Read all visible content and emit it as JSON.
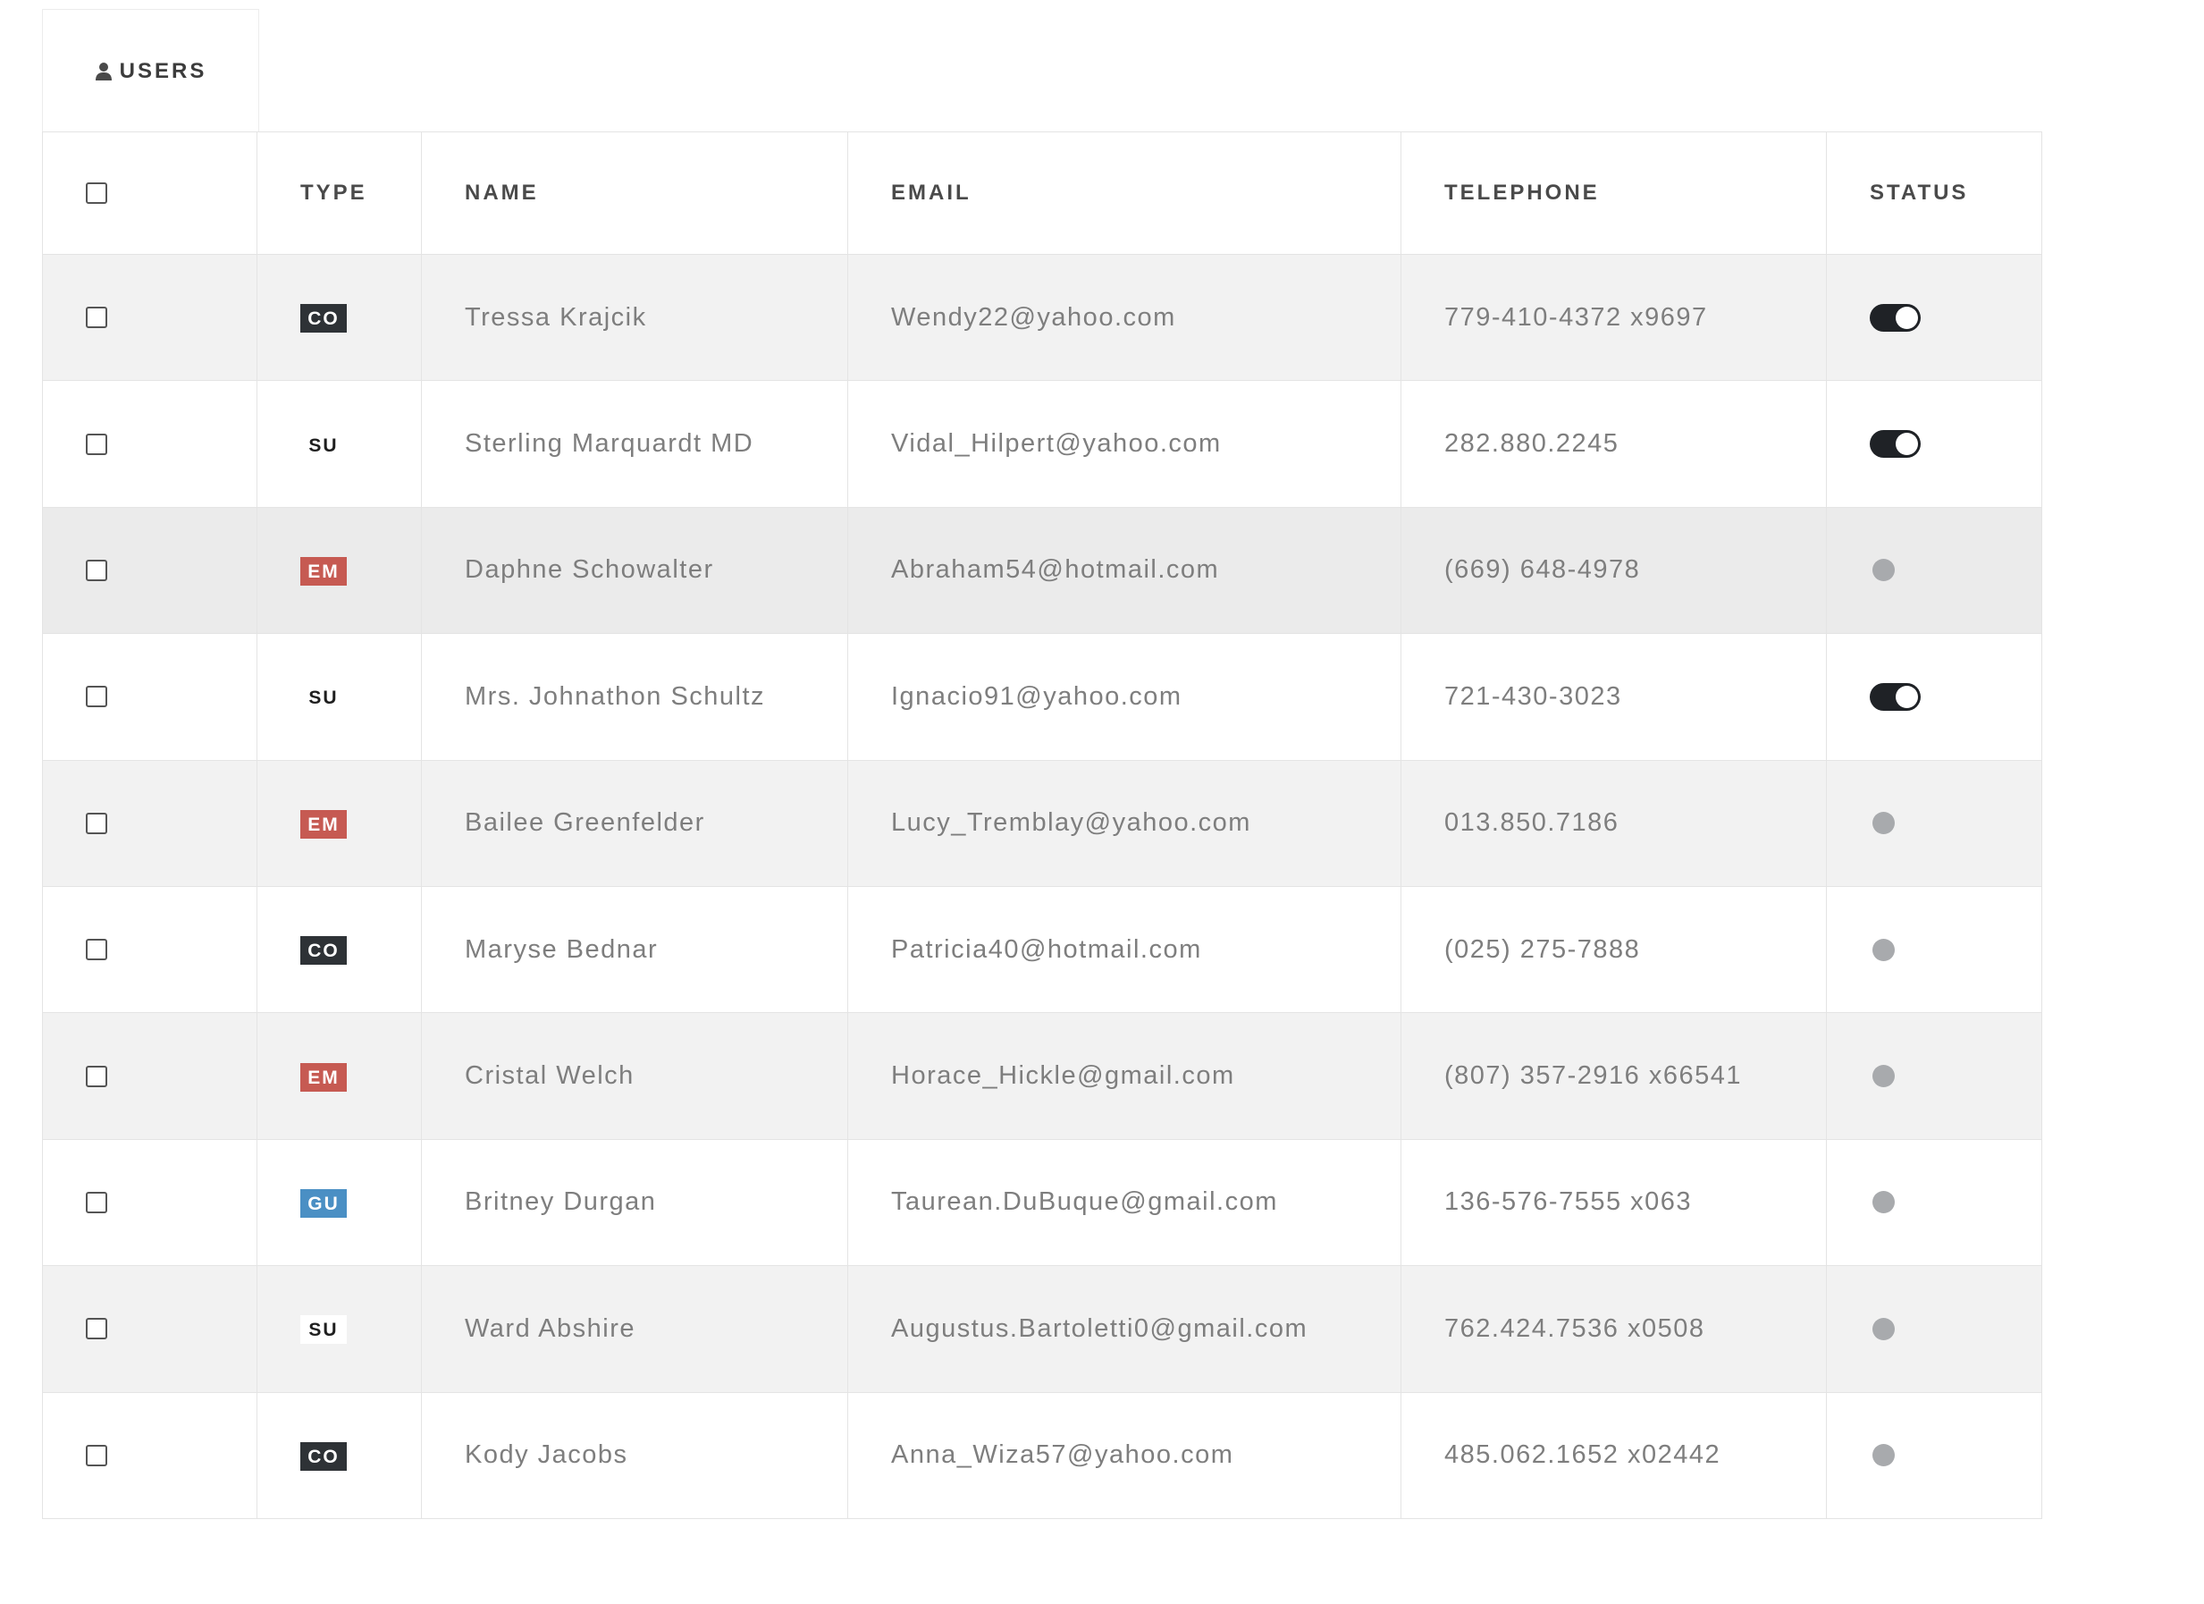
{
  "tab": {
    "label": "USERS",
    "icon": "user-icon"
  },
  "columns": [
    "TYPE",
    "NAME",
    "EMAIL",
    "TELEPHONE",
    "STATUS"
  ],
  "rows": [
    {
      "type": "CO",
      "name": "Tressa Krajcik",
      "email": "Wendy22@yahoo.com",
      "telephone": "779-410-4372 x9697",
      "status": true
    },
    {
      "type": "SU",
      "name": "Sterling Marquardt MD",
      "email": "Vidal_Hilpert@yahoo.com",
      "telephone": "282.880.2245",
      "status": true
    },
    {
      "type": "EM",
      "name": "Daphne Schowalter",
      "email": "Abraham54@hotmail.com",
      "telephone": "(669) 648-4978",
      "status": false
    },
    {
      "type": "SU",
      "name": "Mrs. Johnathon Schultz",
      "email": "Ignacio91@yahoo.com",
      "telephone": "721-430-3023",
      "status": true
    },
    {
      "type": "EM",
      "name": "Bailee Greenfelder",
      "email": "Lucy_Tremblay@yahoo.com",
      "telephone": "013.850.7186",
      "status": false
    },
    {
      "type": "CO",
      "name": "Maryse Bednar",
      "email": "Patricia40@hotmail.com",
      "telephone": "(025) 275-7888",
      "status": false
    },
    {
      "type": "EM",
      "name": "Cristal Welch",
      "email": "Horace_Hickle@gmail.com",
      "telephone": "(807) 357-2916 x66541",
      "status": false
    },
    {
      "type": "GU",
      "name": "Britney Durgan",
      "email": "Taurean.DuBuque@gmail.com",
      "telephone": "136-576-7555 x063",
      "status": false
    },
    {
      "type": "SU",
      "name": "Ward Abshire",
      "email": "Augustus.Bartoletti0@gmail.com",
      "telephone": "762.424.7536 x0508",
      "status": false
    },
    {
      "type": "CO",
      "name": "Kody Jacobs",
      "email": "Anna_Wiza57@yahoo.com",
      "telephone": "485.062.1652 x02442",
      "status": false
    }
  ],
  "colors": {
    "badge_co": "#2e3236",
    "badge_em": "#c65a52",
    "badge_gu": "#4a8fc4",
    "toggle_on": "#1f2226",
    "toggle_off_knob": "#a8aaad",
    "row_stripe": "#f2f2f2",
    "row_highlight": "#ebebeb",
    "border": "#e4e4e4"
  }
}
